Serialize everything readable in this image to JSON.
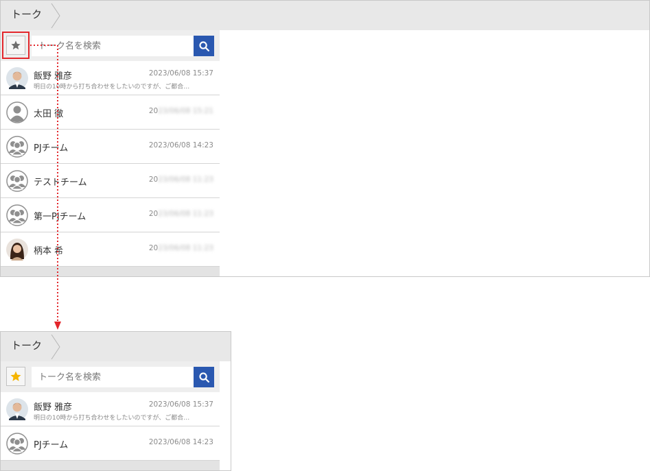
{
  "header": {
    "title": "トーク"
  },
  "search": {
    "placeholder": "トーク名を検索"
  },
  "before": {
    "items": [
      {
        "name": "飯野 雅彦",
        "date": "2023/06/08 15:37",
        "preview": "明日の10時から打ち合わせをしたいのですが、ご都合…",
        "avatar": "photo-man"
      },
      {
        "name": "太田 徹",
        "date_prefix": "20",
        "date_blur": "23/06/08 15:21",
        "avatar": "person"
      },
      {
        "name": "PJチーム",
        "date": "2023/06/08 14:23",
        "avatar": "group"
      },
      {
        "name": "テストチーム",
        "date_prefix": "20",
        "date_blur": "23/06/08 11:23",
        "avatar": "group"
      },
      {
        "name": "第一PJチーム",
        "date_prefix": "20",
        "date_blur": "23/06/08 11:23",
        "avatar": "group"
      },
      {
        "name": "柄本 希",
        "date_prefix": "20",
        "date_blur": "23/06/08 11:23",
        "avatar": "photo-woman"
      }
    ]
  },
  "after": {
    "items": [
      {
        "name": "飯野 雅彦",
        "date": "2023/06/08 15:37",
        "preview": "明日の10時から打ち合わせをしたいのですが、ご都合…",
        "avatar": "photo-man"
      },
      {
        "name": "PJチーム",
        "date": "2023/06/08 14:23",
        "avatar": "group"
      }
    ]
  },
  "icons": {
    "favorite_off": "star-icon",
    "favorite_on": "star-icon-active",
    "search": "search-icon",
    "breadcrumb": "chevron-right-icon"
  },
  "colors": {
    "accent_blue": "#2a58b0",
    "highlight_red": "#e3262b",
    "star_active": "#f5b400",
    "star_inactive": "#6d6d6d"
  }
}
